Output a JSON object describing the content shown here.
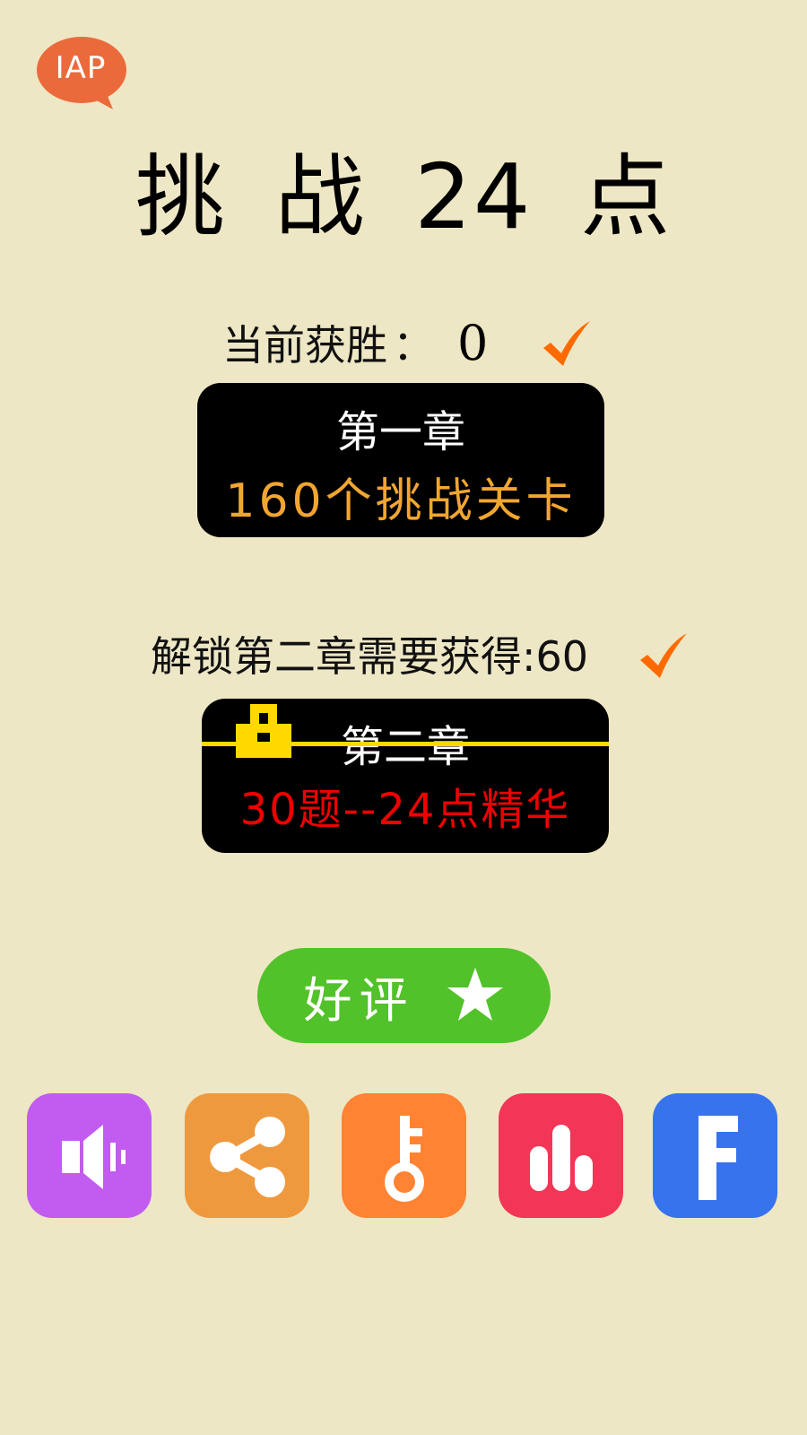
{
  "iap": {
    "label": "IAP",
    "color": "#EB6A3C"
  },
  "title": "挑 战 24 点",
  "wins": {
    "label": "当前获胜",
    "separator": "：",
    "value": "0"
  },
  "chapter1": {
    "title": "第一章",
    "subtitle": "160个挑战关卡",
    "subtitle_color": "#F2A630"
  },
  "unlock": {
    "text": "解锁第二章需要获得:60"
  },
  "chapter2": {
    "title": "第二章",
    "subtitle": "30题--24点精华",
    "subtitle_color": "#F00000",
    "locked": true
  },
  "rate": {
    "label": "好评",
    "color": "#52C22A"
  },
  "bottom_buttons": [
    {
      "icon": "speaker-icon",
      "color": "#C25CF0"
    },
    {
      "icon": "share-icon",
      "color": "#EF993E"
    },
    {
      "icon": "key-icon",
      "color": "#FF8333"
    },
    {
      "icon": "bar-chart-icon",
      "color": "#F33557"
    },
    {
      "icon": "facebook-icon",
      "color": "#3873EE"
    }
  ],
  "colors": {
    "background": "#EEE7C5",
    "check": "#FF6A00",
    "lock": "#FFD800"
  }
}
